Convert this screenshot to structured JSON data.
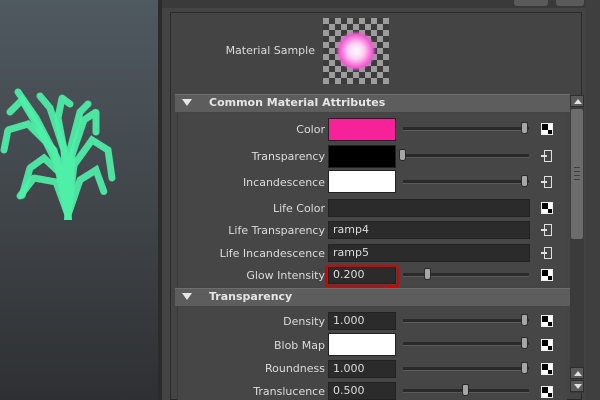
{
  "viewport": {
    "particle_color": "#4ef0a8"
  },
  "material_sample": {
    "label": "Material Sample",
    "glow_color": "#f25ad2"
  },
  "sections": {
    "common": {
      "title": "Common Material Attributes"
    },
    "transparency": {
      "title": "Transparency"
    }
  },
  "common_attrs": {
    "color": {
      "label": "Color",
      "swatch": "#f72299",
      "slider": 0.97
    },
    "transparency": {
      "label": "Transparency",
      "swatch": "#000000",
      "slider": 0.0
    },
    "incandescence": {
      "label": "Incandescence",
      "swatch": "#ffffff",
      "slider": 0.97
    },
    "life_color": {
      "label": "Life Color",
      "value": ""
    },
    "life_transparency": {
      "label": "Life Transparency",
      "value": "ramp4"
    },
    "life_incandescence": {
      "label": "Life Incandescence",
      "value": "ramp5"
    },
    "glow_intensity": {
      "label": "Glow Intensity",
      "value": "0.200",
      "slider": 0.2
    }
  },
  "transparency_attrs": {
    "density": {
      "label": "Density",
      "value": "1.000",
      "slider": 0.97
    },
    "blob_map": {
      "label": "Blob Map",
      "swatch": "#ffffff",
      "slider": 0.97
    },
    "roundness": {
      "label": "Roundness",
      "value": "1.000",
      "slider": 0.97
    },
    "translucence": {
      "label": "Translucence",
      "value": "0.500",
      "slider": 0.5
    }
  },
  "annotation": {
    "highlight_color": "#d60000"
  }
}
